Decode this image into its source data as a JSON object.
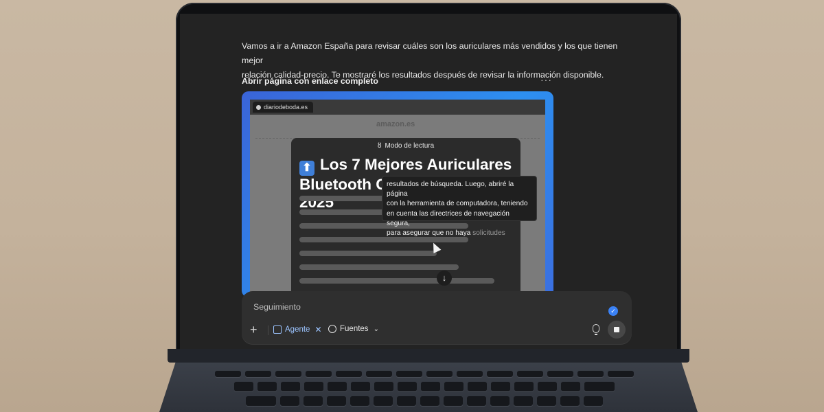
{
  "chat": {
    "intro_line1": "Vamos a ir a Amazon España para revisar cuáles son los auriculares más vendidos y los que tienen mejor",
    "intro_line2": "relación calidad-precio. Te mostraré los resultados después de revisar la información disponible.",
    "step_title": "Abrir página con enlace completo",
    "more_label": "···"
  },
  "browser": {
    "tab_title": "diariodeboda.es",
    "site_logo": "amazon.es"
  },
  "reader": {
    "mode_label": "Modo de lectura",
    "title_emoji": "⬆",
    "title": "Los 7 Mejores Auriculares Bluetooth Calidad-Precio 2025",
    "scroll_icon": "↓"
  },
  "tooltip": {
    "line1": "resultados de búsqueda. Luego, abriré la página",
    "line2": "con la herramienta de computadora, teniendo",
    "line3": "en cuenta las directrices de navegación segura,",
    "line4_main": "para asegurar que no haya ",
    "line4_fade": "solicitudes"
  },
  "composer": {
    "placeholder": "Seguimiento",
    "plus_label": "+",
    "agent_label": "Agente",
    "agent_close": "✕",
    "sources_label": "Fuentes",
    "sources_chevron": "⌄",
    "check": "✓"
  },
  "icons": {
    "more": "more-horizontal-icon",
    "reader": "glasses-icon",
    "agent": "agent-cursor-icon",
    "sources": "globe-icon",
    "mic": "microphone-icon",
    "stop": "stop-icon",
    "check": "check-icon"
  },
  "colors": {
    "screen_bg": "#232323",
    "accent_blue": "#3b82f6",
    "agent_blue": "#9cc4ff"
  }
}
